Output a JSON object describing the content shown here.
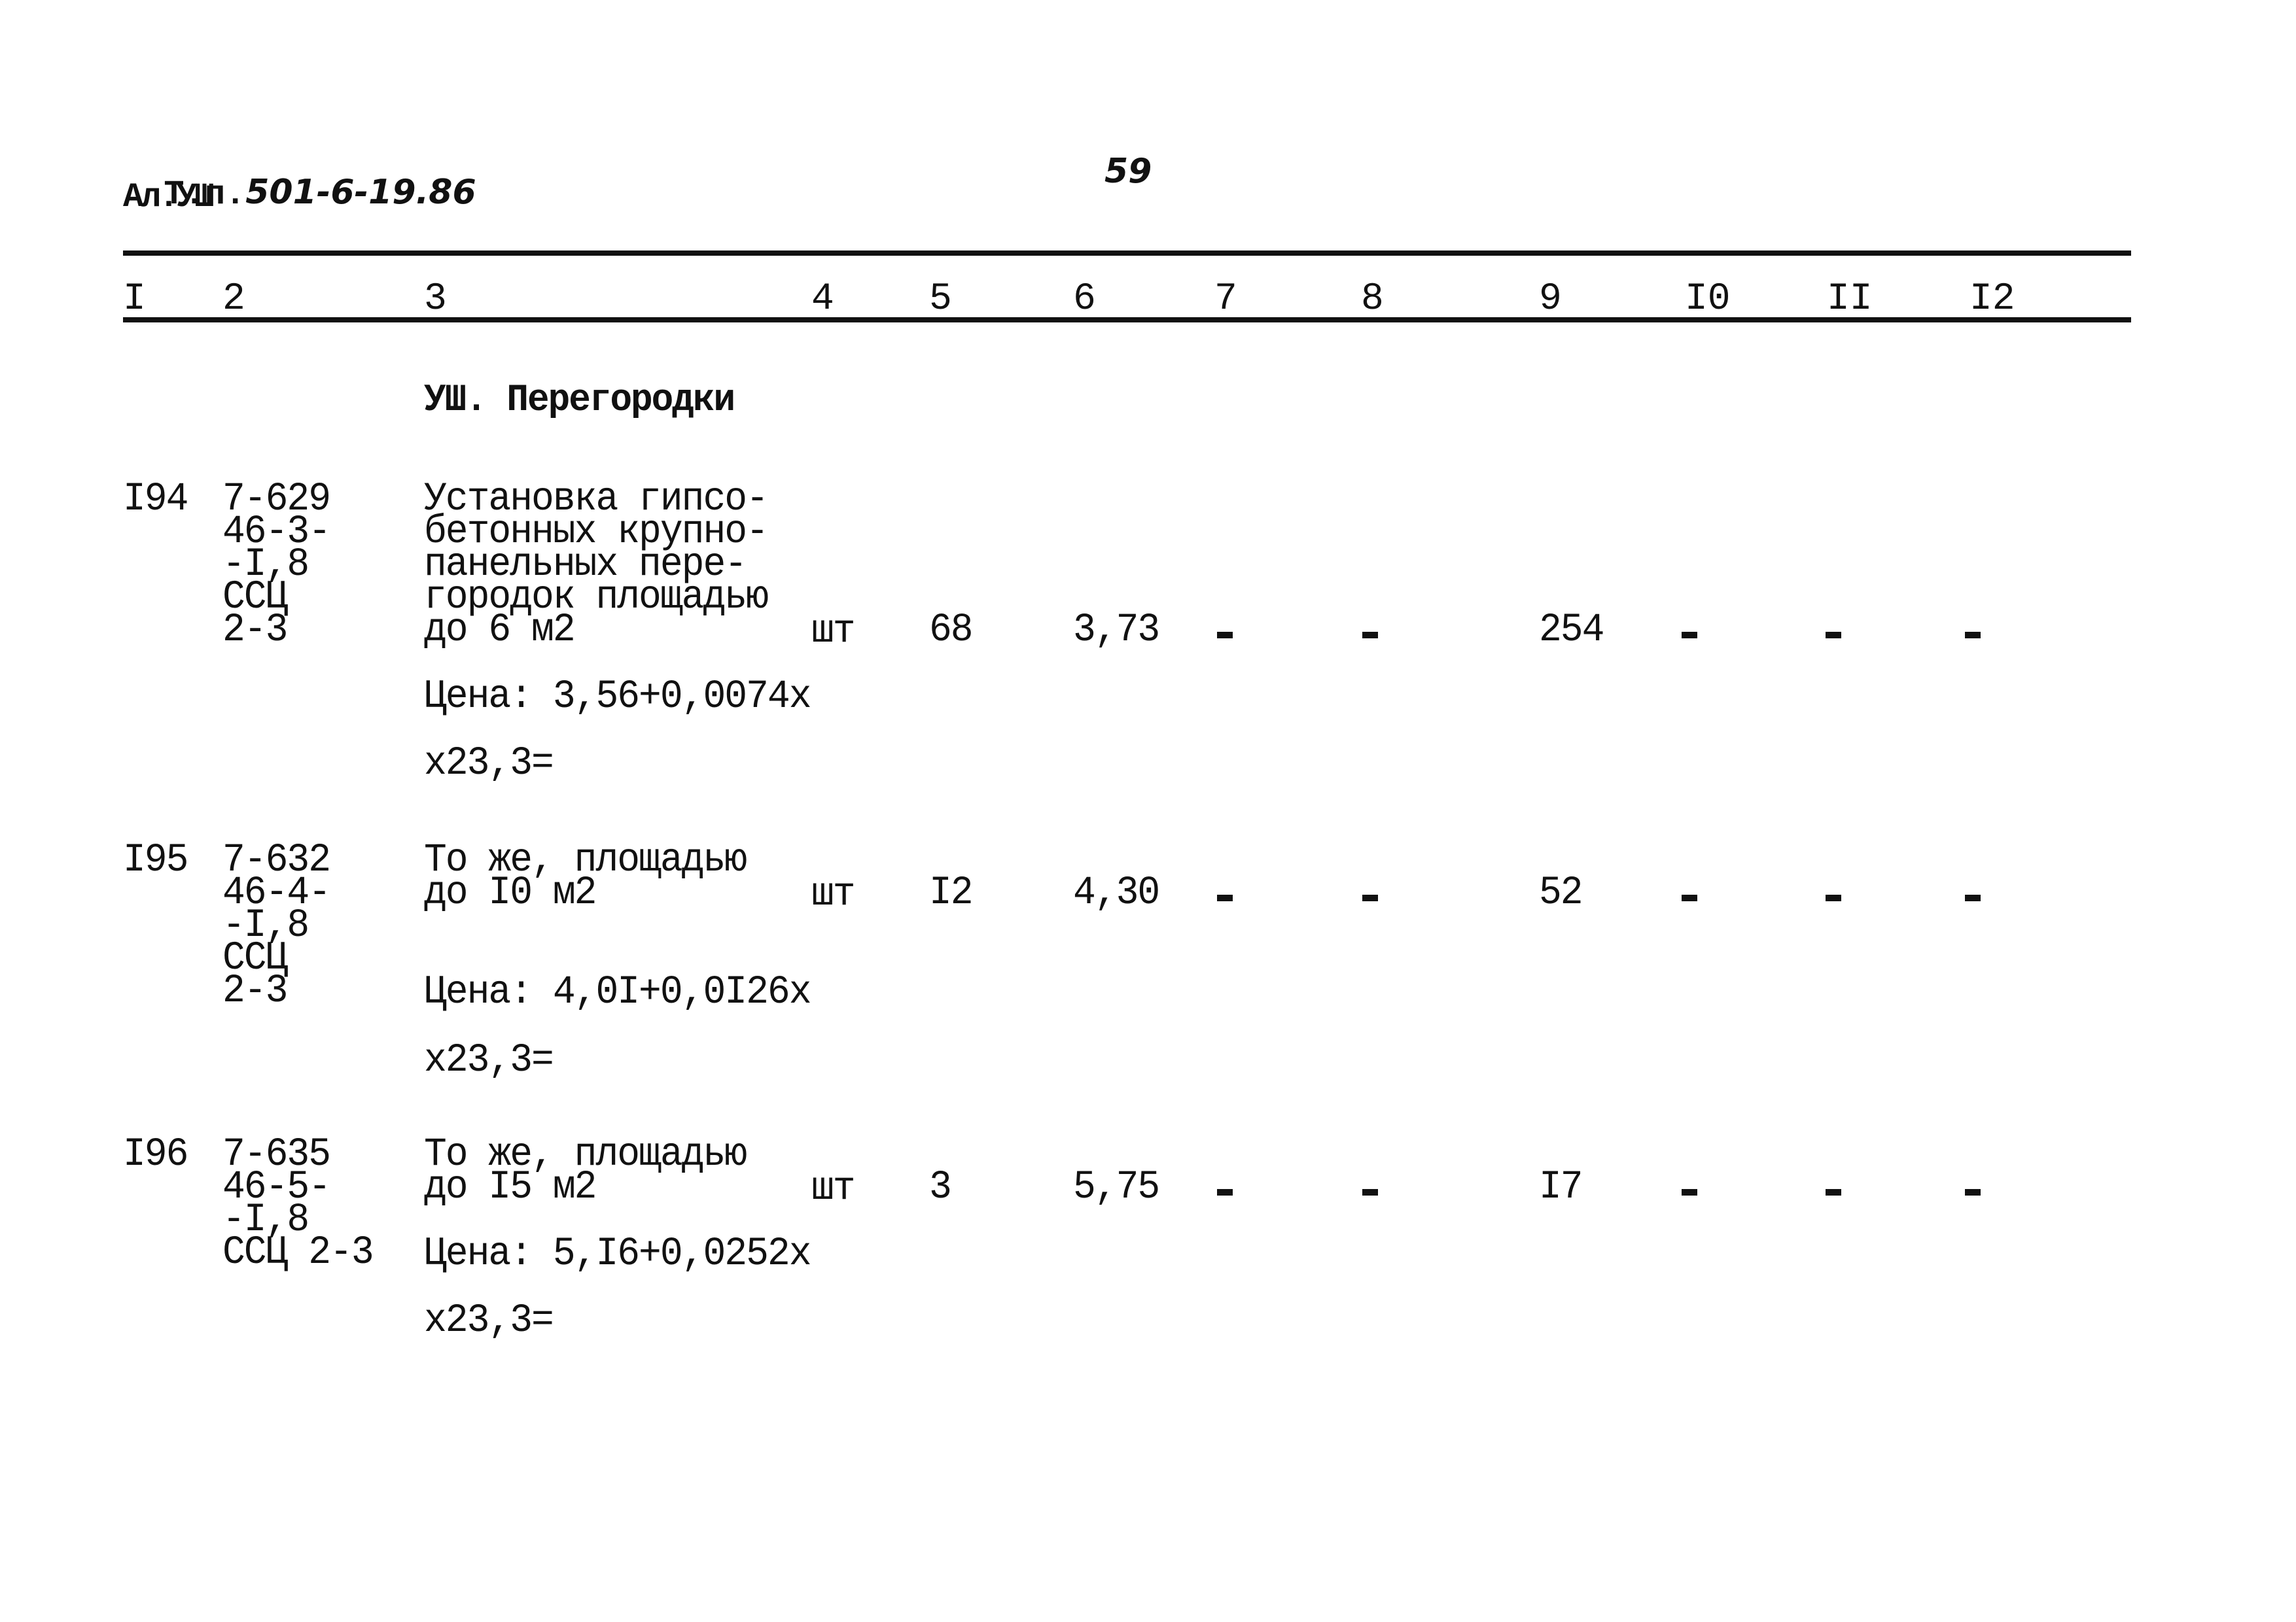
{
  "header": {
    "doc_prefix": "Т.п.",
    "doc_code": "501-6-19.86",
    "album": "Ал.УШ",
    "page_number": "59"
  },
  "columns": [
    "I",
    "2",
    "3",
    "4",
    "5",
    "6",
    "7",
    "8",
    "9",
    "I0",
    "II",
    "I2"
  ],
  "section_title": "УШ. Перегородки",
  "rows": [
    {
      "num": "I94",
      "code_lines": [
        "7-629",
        "46-3-",
        "-I,8",
        "ССЦ",
        "2-3"
      ],
      "desc_lines": [
        "Установка гипсо-",
        "бетонных крупно-",
        "панельных пере-",
        "городок площадью",
        "до 6 м2"
      ],
      "unit": "шт",
      "qty": "68",
      "price": "3,73",
      "col7": "-",
      "col8": "-",
      "col9": "254",
      "col10": "-",
      "col11": "-",
      "col12": "-",
      "price_formula": "Цена: 3,56+0,0074x",
      "multiplier": "x23,3="
    },
    {
      "num": "I95",
      "code_lines": [
        "7-632",
        "46-4-",
        "-I,8",
        "ССЦ",
        "2-3"
      ],
      "desc_lines": [
        "То же, площадью",
        "до I0 м2"
      ],
      "unit": "шт",
      "qty": "I2",
      "price": "4,30",
      "col7": "-",
      "col8": "-",
      "col9": "52",
      "col10": "-",
      "col11": "-",
      "col12": "-",
      "price_formula": "Цена: 4,0I+0,0I26x",
      "multiplier": "x23,3="
    },
    {
      "num": "I96",
      "code_lines": [
        "7-635",
        "46-5-",
        "-I,8",
        "ССЦ 2-3"
      ],
      "desc_lines": [
        "То же, площадью",
        "до I5 м2"
      ],
      "unit": "шт",
      "qty": "3",
      "price": "5,75",
      "col7": "-",
      "col8": "-",
      "col9": "I7",
      "col10": "-",
      "col11": "-",
      "col12": "-",
      "price_formula": "Цена: 5,I6+0,0252x",
      "multiplier": "x23,3="
    }
  ]
}
